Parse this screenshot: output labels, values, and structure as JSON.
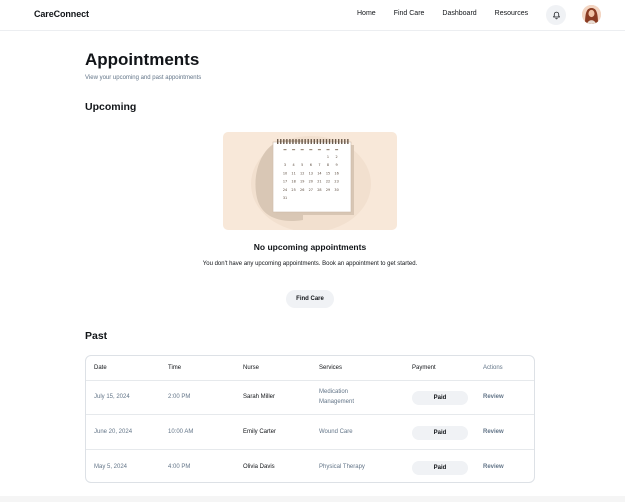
{
  "header": {
    "logo": "CareConnect",
    "nav": [
      "Home",
      "Find Care",
      "Dashboard",
      "Resources"
    ]
  },
  "page": {
    "title": "Appointments",
    "subtitle": "View your upcoming and past appointments"
  },
  "upcoming": {
    "section_title": "Upcoming",
    "empty_title": "No upcoming appointments",
    "empty_text": "You don't have any upcoming appointments. Book an appointment to get started.",
    "button_label": "Find Care",
    "calendar_numbers": [
      "1",
      "2",
      "3",
      "4",
      "5",
      "6",
      "7",
      "8",
      "9",
      "10",
      "11",
      "12",
      "13",
      "14",
      "15",
      "16",
      "17",
      "18",
      "19",
      "20",
      "21",
      "22",
      "23",
      "24",
      "25",
      "26",
      "27",
      "28",
      "29",
      "30",
      "31"
    ]
  },
  "past": {
    "section_title": "Past",
    "columns": [
      "Date",
      "Time",
      "Nurse",
      "Services",
      "Payment",
      "Actions"
    ],
    "rows": [
      {
        "date": "July 15, 2024",
        "time": "2:00 PM",
        "nurse": "Sarah Miller",
        "service_line1": "Medication",
        "service_line2": "Management",
        "payment": "Paid",
        "action": "Review"
      },
      {
        "date": "June 20, 2024",
        "time": "10:00 AM",
        "nurse": "Emily Carter",
        "service_line1": "Wound Care",
        "service_line2": "",
        "payment": "Paid",
        "action": "Review"
      },
      {
        "date": "May 5, 2024",
        "time": "4:00 PM",
        "nurse": "Olivia Davis",
        "service_line1": "Physical Therapy",
        "service_line2": "",
        "payment": "Paid",
        "action": "Review"
      }
    ]
  },
  "colors": {
    "primary_text": "#111418",
    "muted_text": "#637588",
    "pill_bg": "#f0f2f5",
    "illustration_bg": "#f8e8d9"
  },
  "icons": {
    "notification": "bell-icon",
    "profile": "avatar"
  }
}
